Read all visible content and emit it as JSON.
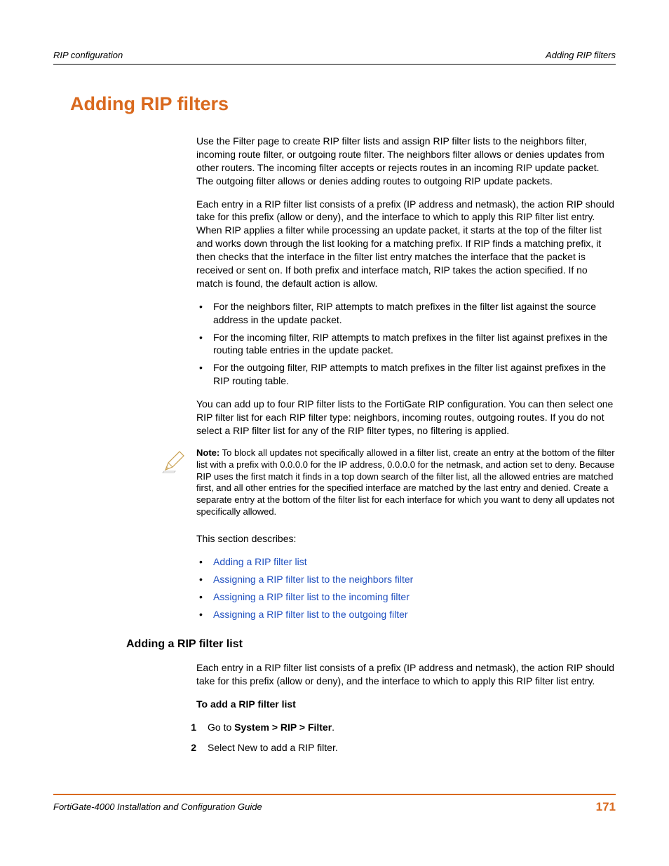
{
  "header": {
    "left": "RIP configuration",
    "right": "Adding RIP filters"
  },
  "h1": "Adding RIP filters",
  "p1": "Use the Filter page to create RIP filter lists and assign RIP filter lists to the neighbors filter, incoming route filter, or outgoing route filter. The neighbors filter allows or denies updates from other routers. The incoming filter accepts or rejects routes in an incoming RIP update packet. The outgoing filter allows or denies adding routes to outgoing RIP update packets.",
  "p2": "Each entry in a RIP filter list consists of a prefix (IP address and netmask), the action RIP should take for this prefix (allow or deny), and the interface to which to apply this RIP filter list entry. When RIP applies a filter while processing an update packet, it starts at the top of the filter list and works down through the list looking for a matching prefix. If RIP finds a matching prefix, it then checks that the interface in the filter list entry matches the interface that the packet is received or sent on. If both prefix and interface match, RIP takes the action specified. If no match is found, the default action is allow.",
  "bul1": [
    "For the neighbors filter, RIP attempts to match prefixes in the filter list against the source address in the update packet.",
    "For the incoming filter, RIP attempts to match prefixes in the filter list against prefixes in the routing table entries in the update packet.",
    "For the outgoing filter, RIP attempts to match prefixes in the filter list against prefixes in the RIP routing table."
  ],
  "p3": "You can add up to four RIP filter lists to the FortiGate RIP configuration. You can then select one RIP filter list for each RIP filter type: neighbors, incoming routes, outgoing routes. If you do not select a RIP filter list for any of the RIP filter types, no filtering is applied.",
  "note": {
    "label": "Note:",
    "body": " To block all updates not specifically allowed in a filter list, create an entry at the bottom of the filter list with a prefix with 0.0.0.0 for the IP address, 0.0.0.0 for the netmask, and action set to deny. Because RIP uses the first match it finds in a top down search of the filter list, all the allowed entries are matched first, and all other entries for the specified interface are matched by the last entry and denied. Create a separate entry at the bottom of the filter list for each interface for which you want to deny all updates not specifically allowed."
  },
  "p4": "This section describes:",
  "links": [
    "Adding a RIP filter list",
    "Assigning a RIP filter list to the neighbors filter",
    "Assigning a RIP filter list to the incoming filter",
    "Assigning a RIP filter list to the outgoing filter"
  ],
  "h3": "Adding a RIP filter list",
  "p5": "Each entry in a RIP filter list consists of a prefix (IP address and netmask), the action RIP should take for this prefix (allow or deny), and the interface to which to apply this RIP filter list entry.",
  "subhead": "To add a RIP filter list",
  "step1": {
    "num": "1",
    "pre": "Go to ",
    "bold": "System > RIP > Filter",
    "post": "."
  },
  "step2": {
    "num": "2",
    "txt": "Select New to add a RIP filter."
  },
  "footer": {
    "left": "FortiGate-4000 Installation and Configuration Guide",
    "right": "171"
  }
}
